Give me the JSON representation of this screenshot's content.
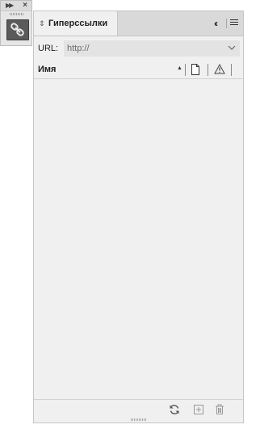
{
  "dock": {
    "expand_icon": "double-chevron-right-icon",
    "close_icon": "close-icon",
    "tool_icon": "hyperlink-chain-icon"
  },
  "panel": {
    "tab_title": "Гиперссылки",
    "collapse_icon": "double-chevron-left-icon",
    "menu_icon": "hamburger-menu-icon",
    "url_label": "URL:",
    "url_value": "http://",
    "columns": {
      "name": "Имя",
      "sort_icon": "sort-ascending-icon",
      "page_icon": "page-icon",
      "status_icon": "warning-icon"
    },
    "items": [],
    "footer": {
      "refresh_icon": "refresh-icon",
      "new_icon": "new-hyperlink-icon",
      "delete_icon": "trash-icon"
    }
  },
  "colors": {
    "panel_bg": "#f0f0f0",
    "tabbar_bg": "#d9d9d9",
    "field_bg": "#e3e3e3",
    "tool_bg": "#5a5a5a"
  }
}
